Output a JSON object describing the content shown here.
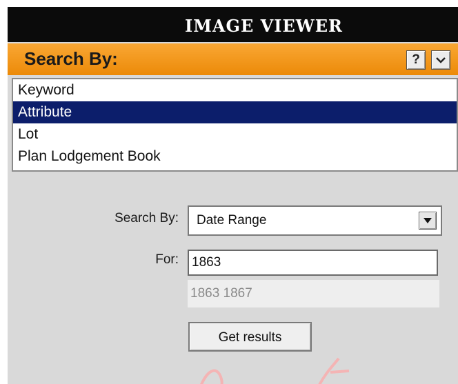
{
  "window": {
    "title": "IMAGE VIEWER"
  },
  "search_header": {
    "label": "Search By:",
    "help_label": "?",
    "collapse_icon": "chevron-down-icon"
  },
  "search_types": [
    {
      "label": "Keyword",
      "selected": false
    },
    {
      "label": "Attribute",
      "selected": true
    },
    {
      "label": "Lot",
      "selected": false
    },
    {
      "label": "Plan Lodgement Book",
      "selected": false
    }
  ],
  "form": {
    "search_by_label": "Search By:",
    "search_by_value": "Date Range",
    "for_label": "For:",
    "for_value": "1863",
    "suggestion": "1863 1867",
    "submit_label": "Get results"
  },
  "colors": {
    "title_bg": "#0b0b0b",
    "header_orange": "#f39a1e",
    "selection": "#0c1e6b",
    "panel_bg": "#d9d9d9"
  }
}
